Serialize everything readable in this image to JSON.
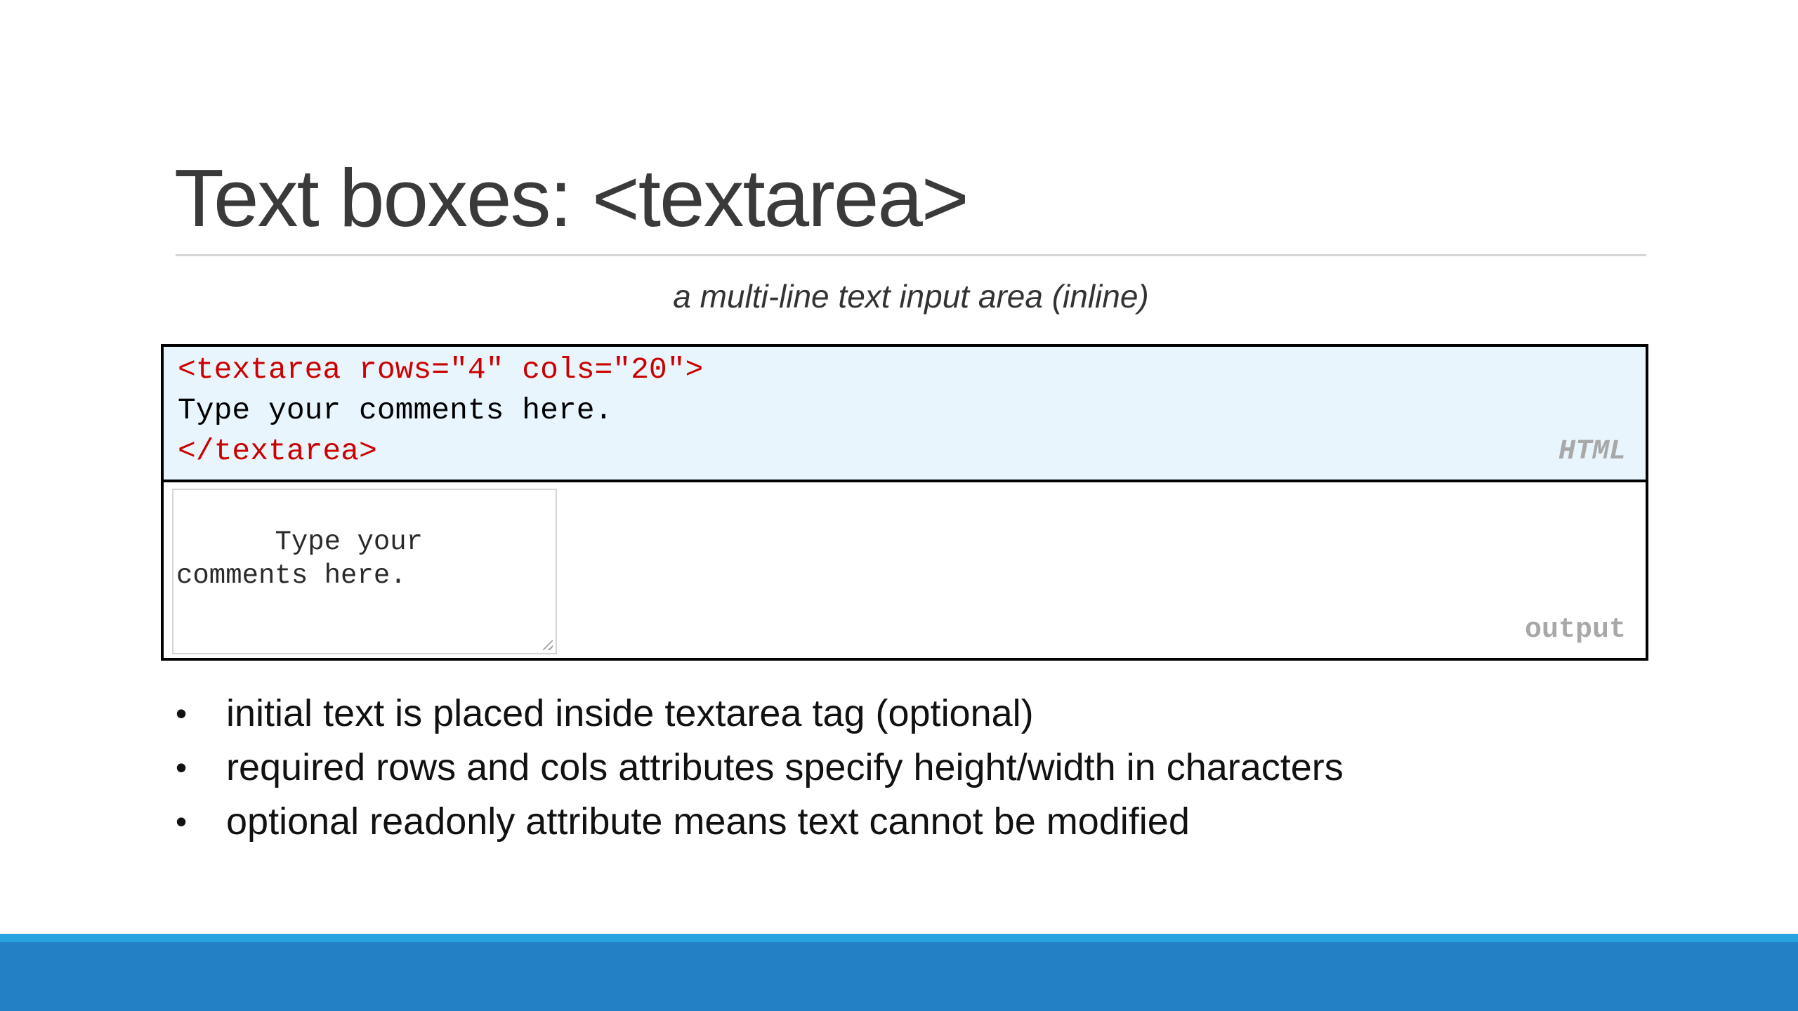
{
  "slide": {
    "title": "Text boxes: <textarea>",
    "subtitle": "a multi-line text input area (inline)"
  },
  "code_example": {
    "lines": [
      "<textarea rows=\"4\" cols=\"20\">",
      "Type your comments here.",
      "</textarea>"
    ],
    "tag": "HTML"
  },
  "output_example": {
    "textarea_value": "Type your comments here.",
    "tag": "output"
  },
  "bullets": [
    "initial text is placed inside textarea tag (optional)",
    "required rows and cols attributes specify height/width in characters",
    "optional readonly attribute means text cannot be modified"
  ],
  "bullet_symbol": "•",
  "colors": {
    "code_background": "#e9f5fd",
    "code_tag_color": "#cc0000",
    "footer_light": "#29a3e0",
    "footer_dark": "#2480c4"
  }
}
